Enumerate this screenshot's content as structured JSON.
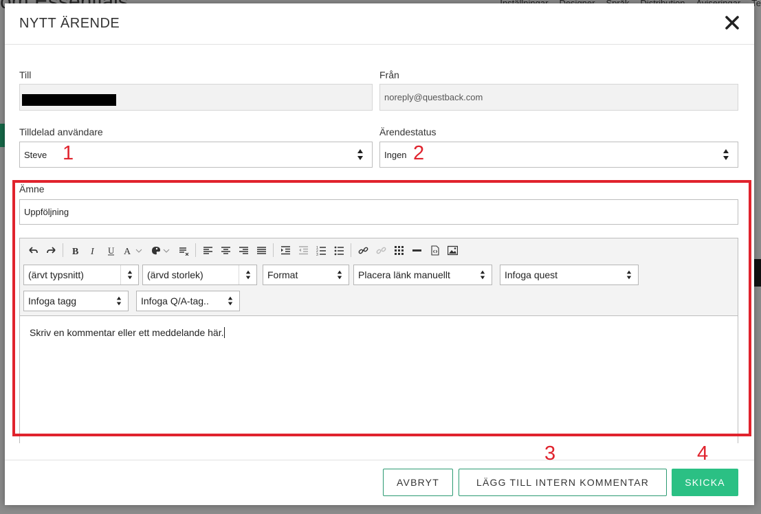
{
  "background": {
    "title": "om Essentials",
    "nav": [
      "Inställningar",
      "Designer",
      "Språk",
      "Distribution",
      "Aviseringar",
      "Te"
    ]
  },
  "modal": {
    "title": "NYTT ÄRENDE",
    "close_icon": "close-icon"
  },
  "form": {
    "to_label": "Till",
    "to_value": "",
    "from_label": "Från",
    "from_value": "noreply@questback.com",
    "assigned_label": "Tilldelad användare",
    "assigned_value": "Steve",
    "status_label": "Ärendestatus",
    "status_value": "Ingen",
    "subject_label": "Ämne",
    "subject_value": "Uppföljning"
  },
  "editor": {
    "font_select": "(ärvt typsnitt)",
    "size_select": "(ärvd storlek)",
    "format_select": "Format",
    "link_select": "Placera länk manuellt",
    "quest_select": "Infoga quest",
    "tag_select": "Infoga tagg",
    "qa_tag_select": "Infoga Q/A-tag..",
    "body_text": "Skriv en kommentar eller ett meddelande här."
  },
  "annotations": [
    "1",
    "2",
    "3",
    "4"
  ],
  "footer": {
    "cancel": "AVBRYT",
    "internal_comment": "LÄGG TILL INTERN KOMMENTAR",
    "send": "SKICKA"
  },
  "colors": {
    "annotation_red": "#e0232d",
    "primary_green": "#2bc084",
    "border_green": "#2a9a71"
  }
}
